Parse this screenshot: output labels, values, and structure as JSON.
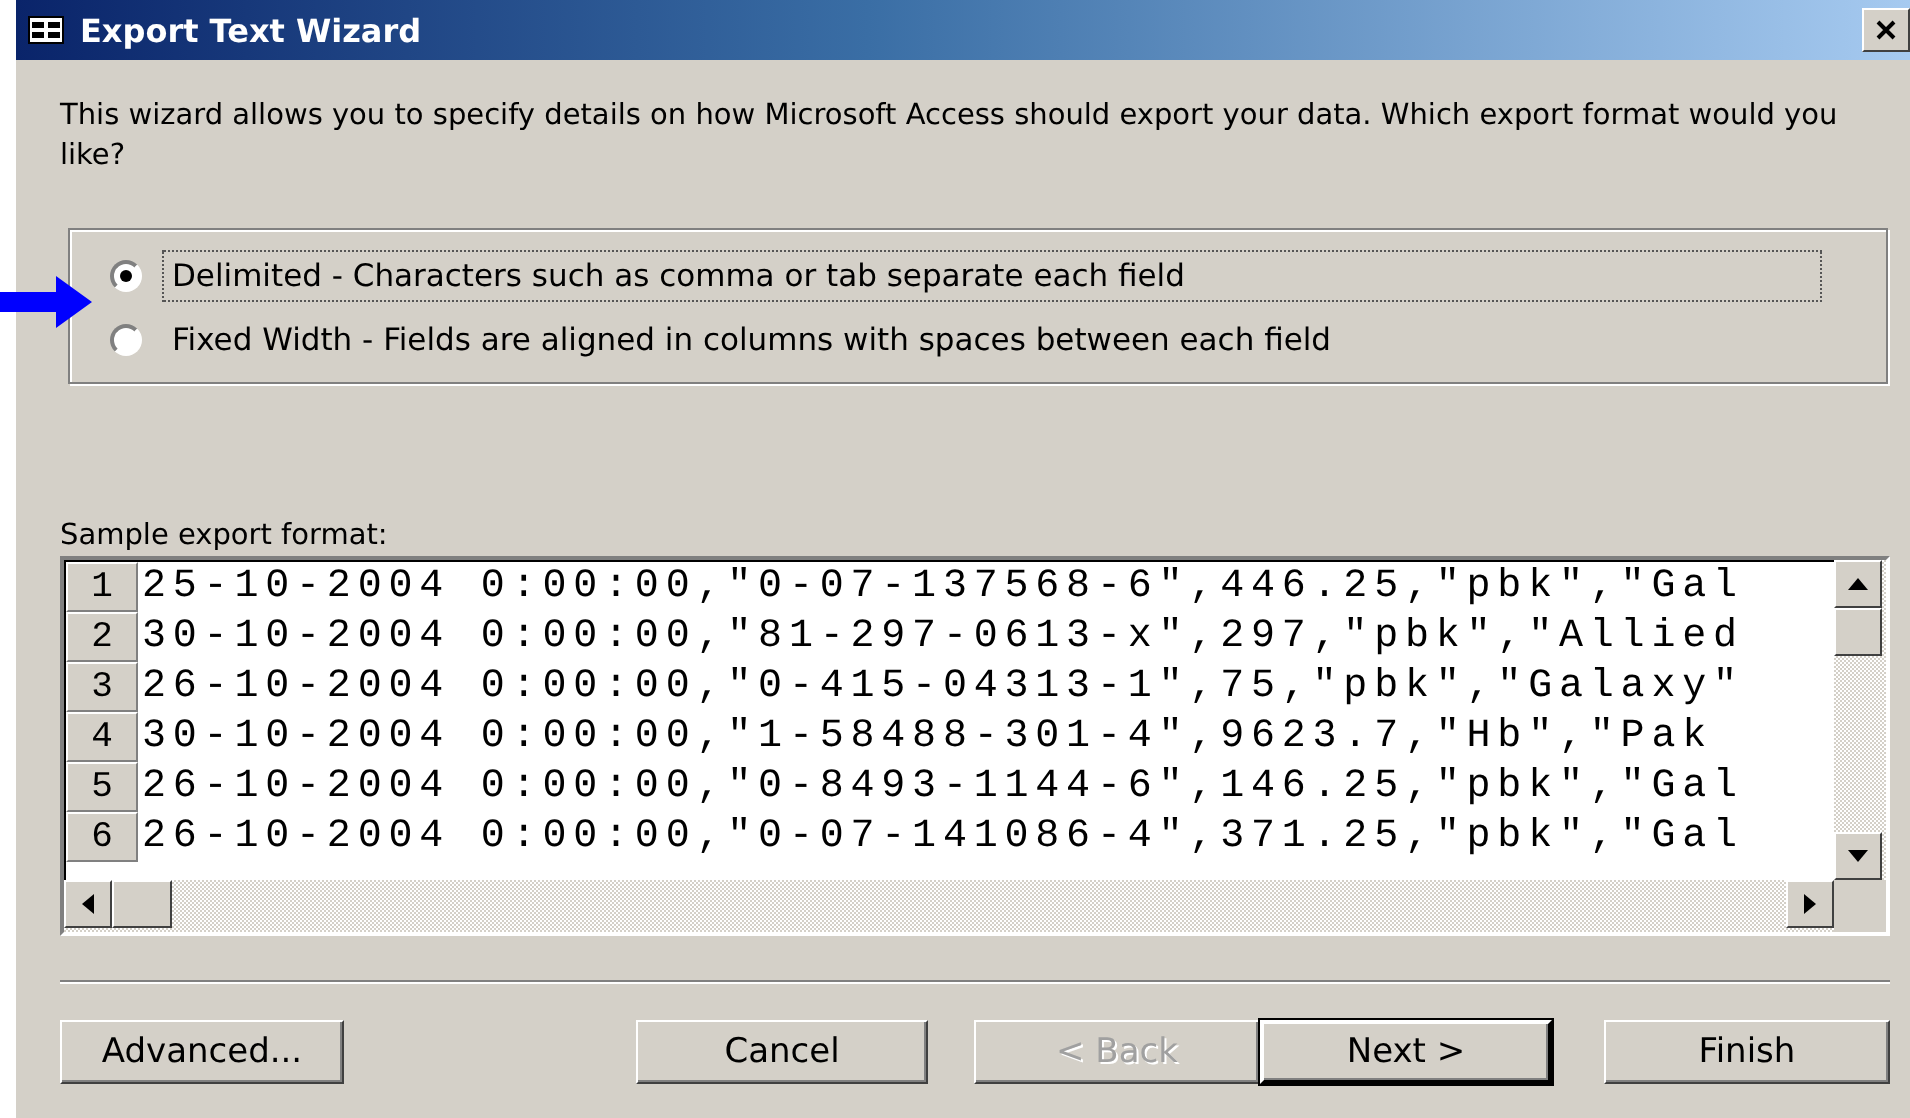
{
  "window": {
    "title": "Export Text Wizard"
  },
  "intro": "This wizard allows you to specify details on how Microsoft Access should export your data. Which export format would you like?",
  "format_options": [
    {
      "label": "Delimited - Characters such as comma or tab separate each field",
      "selected": true
    },
    {
      "label": "Fixed Width - Fields are aligned in columns with spaces between each field",
      "selected": false
    }
  ],
  "sample": {
    "label": "Sample export format:",
    "rows": [
      {
        "number": "1",
        "text": "25-10-2004 0:00:00,\"0-07-137568-6\",446.25,\"pbk\",\"Gal"
      },
      {
        "number": "2",
        "text": "30-10-2004 0:00:00,\"81-297-0613-x\",297,\"pbk\",\"Allied"
      },
      {
        "number": "3",
        "text": "26-10-2004 0:00:00,\"0-415-04313-1\",75,\"pbk\",\"Galaxy\""
      },
      {
        "number": "4",
        "text": "30-10-2004 0:00:00,\"1-58488-301-4\",9623.7,\"Hb\",\"Pak"
      },
      {
        "number": "5",
        "text": "26-10-2004 0:00:00,\"0-8493-1144-6\",146.25,\"pbk\",\"Gal"
      },
      {
        "number": "6",
        "text": "26-10-2004 0:00:00,\"0-07-141086-4\",371.25,\"pbk\",\"Gal"
      }
    ]
  },
  "buttons": [
    {
      "label": "Advanced...",
      "disabled": false,
      "default": false
    },
    {
      "label": "Cancel",
      "disabled": false,
      "default": false
    },
    {
      "label": "< Back",
      "disabled": true,
      "default": false
    },
    {
      "label": "Next >",
      "disabled": false,
      "default": true
    },
    {
      "label": "Finish",
      "disabled": false,
      "default": false
    }
  ]
}
